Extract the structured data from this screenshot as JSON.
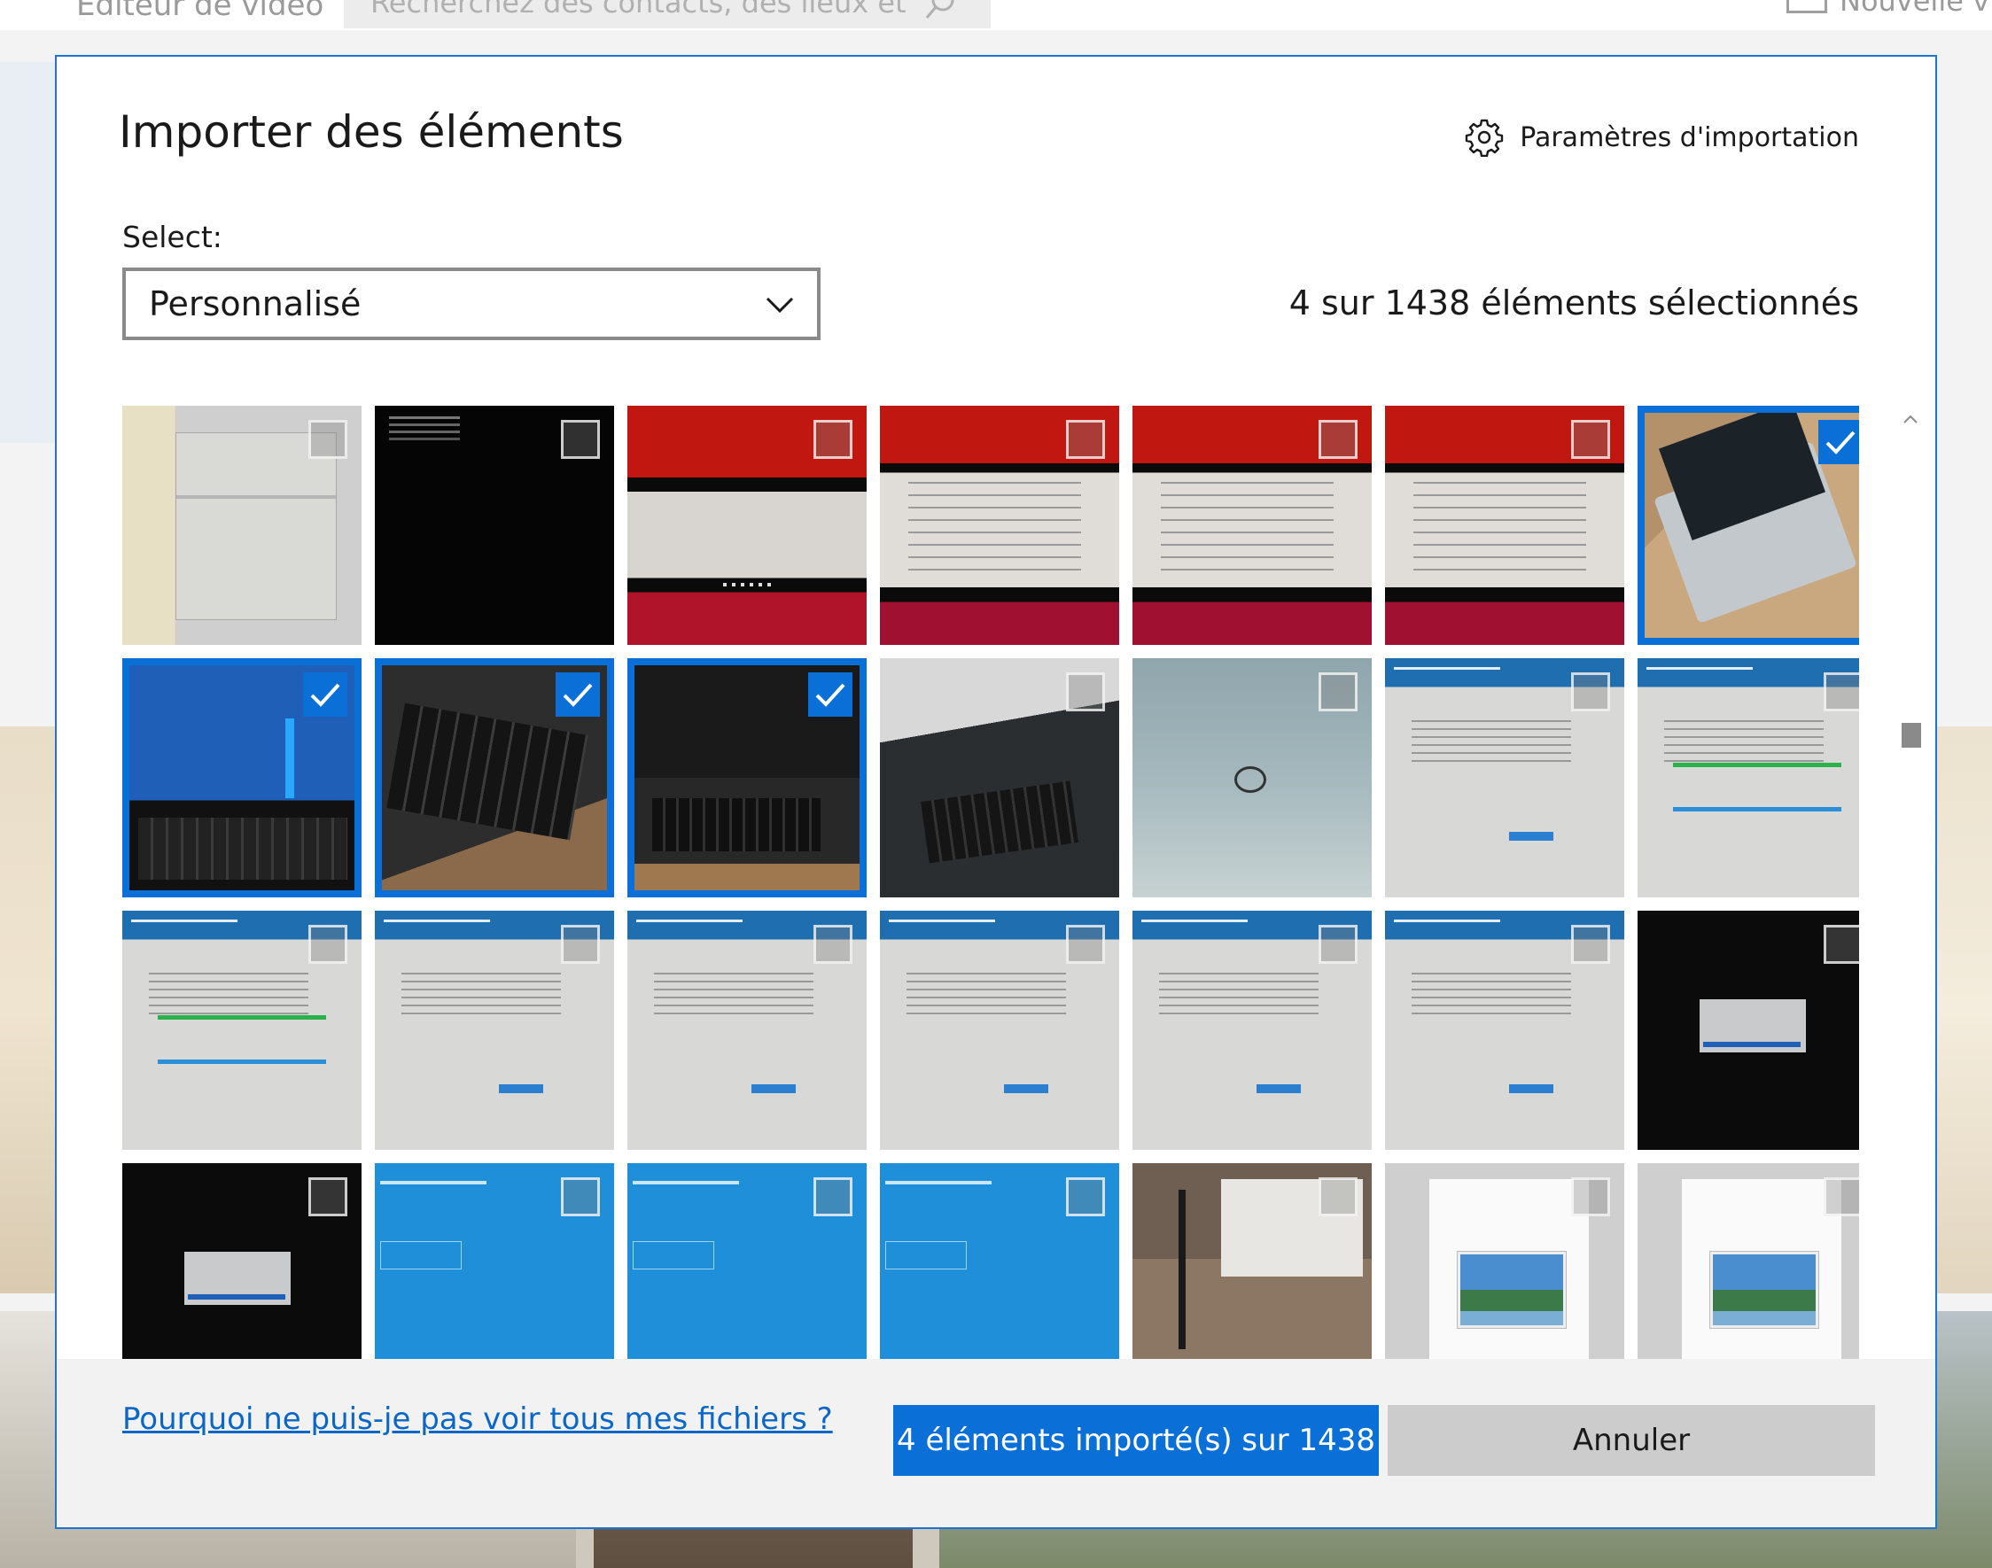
{
  "background": {
    "app_title": "Éditeur de vidéo",
    "search_placeholder": "Recherchez des contacts, des lieux et",
    "new_video_label": "Nouvelle vidéo"
  },
  "dialog": {
    "title": "Importer des éléments",
    "settings_label": "Paramètres d'importation",
    "select_label": "Select:",
    "select_value": "Personnalisé",
    "selection_count": "4 sur 1438 éléments sélectionnés",
    "tiles": [
      {
        "kind": "t-doc",
        "selected": false
      },
      {
        "kind": "t-black",
        "selected": false
      },
      {
        "kind": "t-red",
        "selected": false
      },
      {
        "kind": "t-redb",
        "selected": false
      },
      {
        "kind": "t-redb",
        "selected": false
      },
      {
        "kind": "t-redb",
        "selected": false
      },
      {
        "kind": "t-laptop-box",
        "selected": true
      },
      {
        "kind": "t-blue-screen",
        "selected": true
      },
      {
        "kind": "t-keyboard",
        "selected": true
      },
      {
        "kind": "t-laptop-open",
        "selected": true
      },
      {
        "kind": "t-laptop-angle",
        "selected": false
      },
      {
        "kind": "t-laptop-lid",
        "selected": false
      },
      {
        "kind": "t-recovery",
        "selected": false
      },
      {
        "kind": "t-recovery-bars",
        "selected": false
      },
      {
        "kind": "t-recovery-bars",
        "selected": false
      },
      {
        "kind": "t-recovery",
        "selected": false
      },
      {
        "kind": "t-recovery",
        "selected": false
      },
      {
        "kind": "t-recovery",
        "selected": false
      },
      {
        "kind": "t-recovery",
        "selected": false
      },
      {
        "kind": "t-recovery",
        "selected": false
      },
      {
        "kind": "t-dark-box",
        "selected": false
      },
      {
        "kind": "t-dark-box",
        "selected": false
      },
      {
        "kind": "t-blue",
        "selected": false
      },
      {
        "kind": "t-blue",
        "selected": false
      },
      {
        "kind": "t-blue",
        "selected": false
      },
      {
        "kind": "t-projector",
        "selected": false
      },
      {
        "kind": "t-file",
        "selected": false
      },
      {
        "kind": "t-file",
        "selected": false
      }
    ],
    "footer": {
      "why_link": "Pourquoi ne puis-je pas voir tous mes fichiers ?",
      "import_button": "4 éléments importé(s) sur 1438",
      "cancel_button": "Annuler"
    }
  },
  "icons": {
    "settings": "gear-icon",
    "dropdown": "chevron-down-icon",
    "checkbox_checked": "checkmark-icon",
    "scroll_up": "chevron-up-icon",
    "scroll_down": "chevron-down-icon",
    "search": "search-icon"
  },
  "colors": {
    "accent": "#0a6fd6",
    "dialog_border": "#1e74d3",
    "link": "#0a67c8",
    "cancel_bg": "#cccccc",
    "footer_bg": "#f2f2f2"
  }
}
